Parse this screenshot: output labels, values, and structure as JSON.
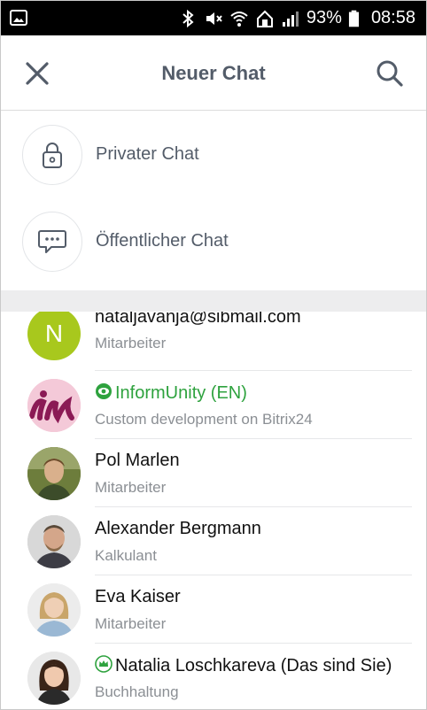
{
  "status_bar": {
    "battery": "93%",
    "time": "08:58"
  },
  "header": {
    "title": "Neuer Chat",
    "close_icon": "close-icon",
    "search_icon": "search-icon"
  },
  "actions": [
    {
      "label": "Privater Chat",
      "icon": "lock-icon"
    },
    {
      "label": "Öffentlicher Chat",
      "icon": "chat-bubble-icon"
    }
  ],
  "contacts": [
    {
      "name": "nataljavanja@sibmail.com",
      "subtitle": "Mitarbeiter",
      "avatar_letter": "N",
      "avatar_color": "#a8c81d"
    },
    {
      "name": "InformUnity (EN)",
      "subtitle": "Custom development on Bitrix24",
      "name_color": "#2ea23e",
      "badge_icon": "extranet-eye-icon"
    },
    {
      "name": "Pol Marlen",
      "subtitle": "Mitarbeiter"
    },
    {
      "name": "Alexander Bergmann",
      "subtitle": "Kalkulant"
    },
    {
      "name": "Eva Kaiser",
      "subtitle": "Mitarbeiter"
    },
    {
      "name": "Natalia Loschkareva (Das sind Sie)",
      "subtitle": "Buchhaltung",
      "badge_icon": "crown-icon"
    }
  ],
  "colors": {
    "header_text": "#535c69",
    "secondary_text": "#8b8f94",
    "extranet_green": "#2ea23e",
    "separator": "#ededee"
  }
}
